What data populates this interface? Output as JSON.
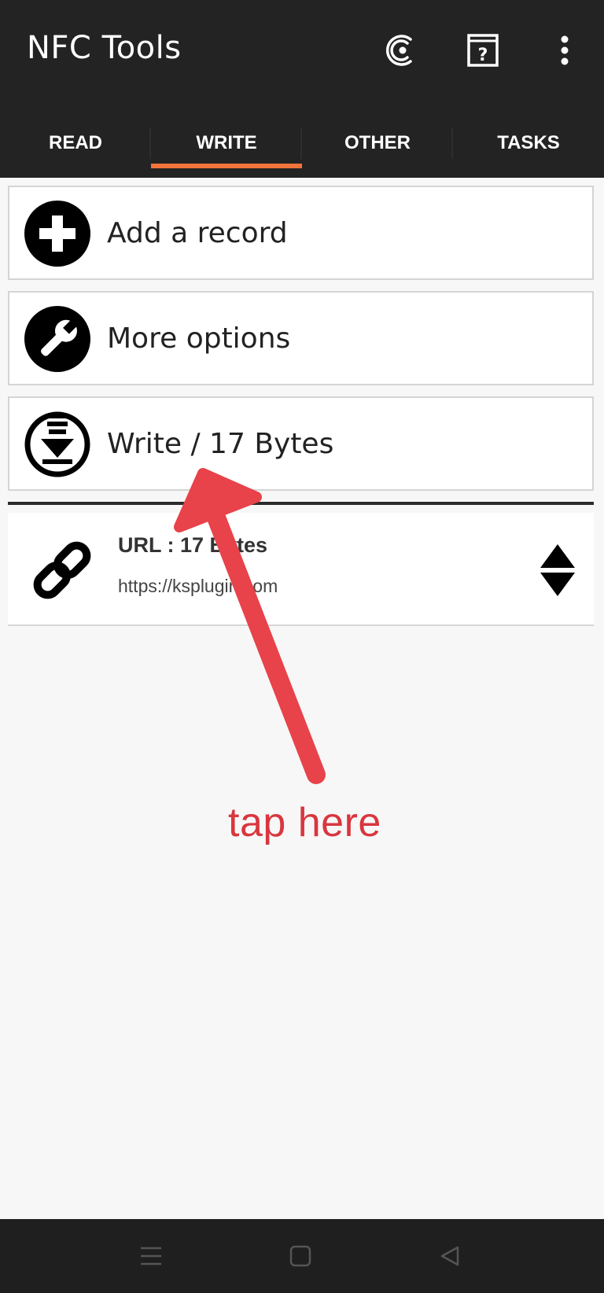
{
  "app": {
    "title": "NFC Tools"
  },
  "toolbar": {
    "icons": [
      "nfc-compat-icon",
      "help-book-icon",
      "more-vert-icon"
    ]
  },
  "tabs": [
    {
      "label": "READ",
      "active": false
    },
    {
      "label": "WRITE",
      "active": true
    },
    {
      "label": "OTHER",
      "active": false
    },
    {
      "label": "TASKS",
      "active": false
    }
  ],
  "actions": {
    "add_record": {
      "label": "Add a record",
      "icon": "plus-circle-icon"
    },
    "more_options": {
      "label": "More options",
      "icon": "wrench-icon"
    },
    "write": {
      "label": "Write / 17 Bytes",
      "icon": "download-circle-icon"
    }
  },
  "records": [
    {
      "title": "URL : 17 Bytes",
      "value": "https://ksplugin.com",
      "icon": "link-icon"
    }
  ],
  "annotation": {
    "text": "tap here",
    "color": "#d9363e"
  },
  "colors": {
    "appbar": "#232323",
    "tab_indicator": "#f2743b",
    "background": "#f7f7f7",
    "navbar": "#1f1f1f"
  },
  "navbar": {
    "icons": [
      "menu-icon",
      "home-square-icon",
      "back-triangle-icon"
    ]
  }
}
